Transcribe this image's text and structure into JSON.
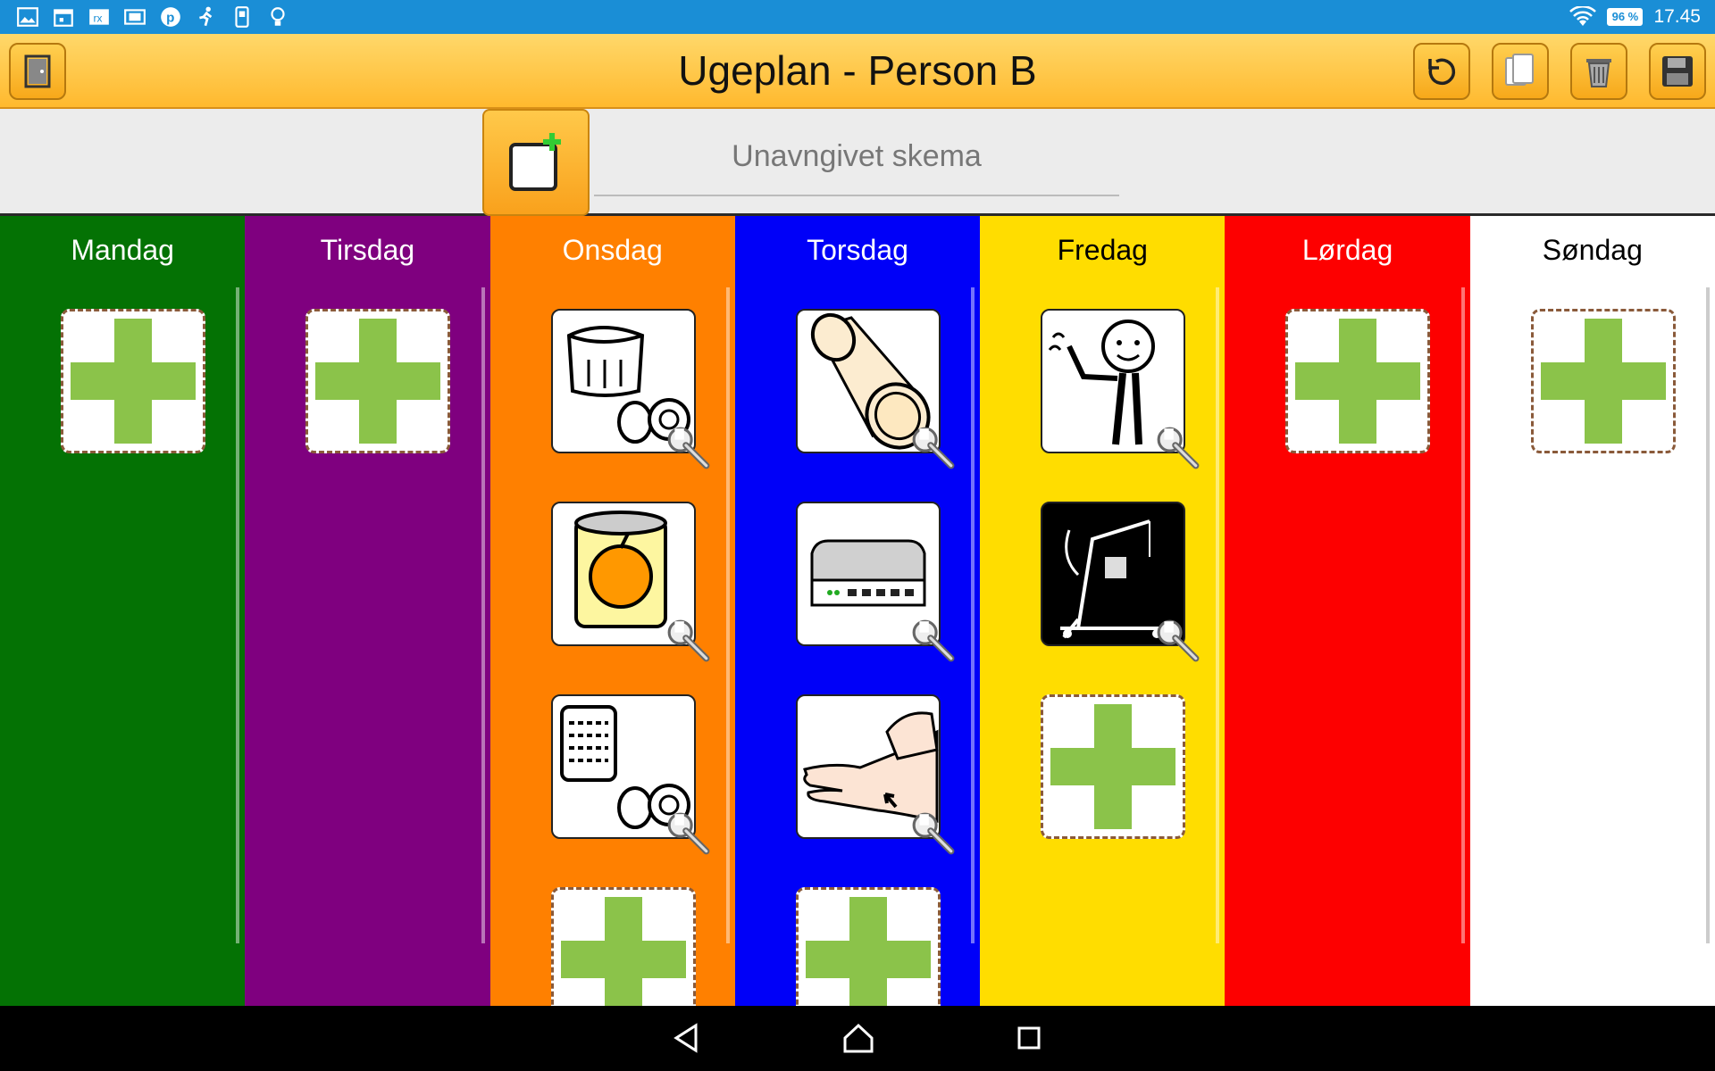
{
  "status_bar": {
    "time": "17.45",
    "battery": "96 %",
    "notification_icons": [
      "gallery-icon",
      "calendar-icon",
      "app-icon",
      "tv-icon",
      "pinterest-icon",
      "runner-icon",
      "phone-icon",
      "bulb-icon"
    ]
  },
  "app_bar": {
    "title": "Ugeplan - Person B",
    "left_button": "exit-icon",
    "right_buttons": [
      "undo-icon",
      "copy-icon",
      "trash-icon",
      "save-icon"
    ]
  },
  "toolbar": {
    "schema_placeholder": "Unavngivet skema"
  },
  "colors": {
    "Mandag": "#047204",
    "Tirsdag": "#7f007f",
    "Onsdag": "#ff8000",
    "Torsdag": "#0000f8",
    "Fredag": "#ffdd00",
    "Lørdag": "#fd0000",
    "Søndag": "#ffffff"
  },
  "days": [
    {
      "name": "Mandag",
      "items": [
        "add"
      ]
    },
    {
      "name": "Tirsdag",
      "items": [
        "add"
      ]
    },
    {
      "name": "Onsdag",
      "items": [
        "jam-jar-pictogram",
        "canned-fruit-pictogram",
        "tin-can-pictogram",
        "add"
      ]
    },
    {
      "name": "Torsdag",
      "items": [
        "foam-roller-pictogram",
        "router-pictogram",
        "hand-massage-pictogram",
        "add"
      ]
    },
    {
      "name": "Fredag",
      "items": [
        "waving-person-pictogram",
        "patient-lift-pictogram",
        "add"
      ]
    },
    {
      "name": "Lørdag",
      "items": [
        "add"
      ]
    },
    {
      "name": "Søndag",
      "items": [
        "add"
      ]
    }
  ]
}
